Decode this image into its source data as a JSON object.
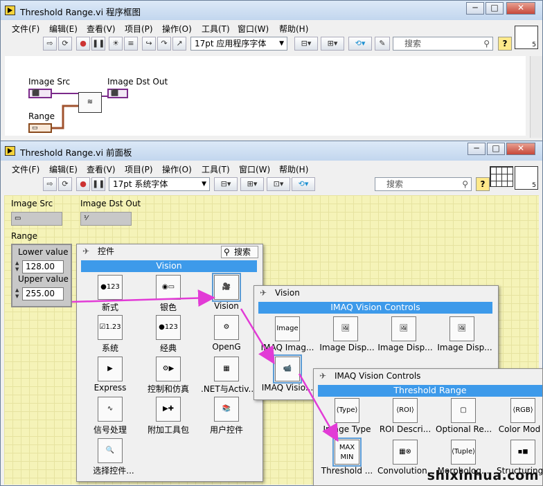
{
  "block_diagram": {
    "title": "Threshold Range.vi 程序框图",
    "menus": [
      "文件(F)",
      "编辑(E)",
      "查看(V)",
      "项目(P)",
      "操作(O)",
      "工具(T)",
      "窗口(W)",
      "帮助(H)"
    ],
    "font_select": "17pt 应用程序字体",
    "search_placeholder": "搜索",
    "labels": {
      "image_src": "Image Src",
      "image_dst_out": "Image Dst Out",
      "range": "Range"
    },
    "help": "?",
    "corner": "5"
  },
  "front_panel": {
    "title": "Threshold Range.vi 前面板",
    "menus": [
      "文件(F)",
      "编辑(E)",
      "查看(V)",
      "项目(P)",
      "操作(O)",
      "工具(T)",
      "窗口(W)",
      "帮助(H)"
    ],
    "font_select": "17pt 系统字体",
    "search_placeholder": "搜索",
    "help": "?",
    "corner": "5",
    "labels": {
      "image_src": "Image Src",
      "image_dst_out": "Image Dst Out",
      "range": "Range"
    },
    "range": {
      "lower_label": "Lower value",
      "lower_value": "128.00",
      "upper_label": "Upper value",
      "upper_value": "255.00"
    }
  },
  "palette_controls": {
    "title": "控件",
    "search": "搜索",
    "header": "Vision",
    "items": [
      "新式",
      "银色",
      "Vision",
      "系统",
      "经典",
      "OpenG",
      "Express",
      "控制和仿真",
      ".NET与Activ...",
      "信号处理",
      "附加工具包",
      "用户控件",
      "选择控件..."
    ]
  },
  "palette_vision": {
    "title": "Vision",
    "header": "IMAQ Vision Controls",
    "items": [
      "IMAQ Imag...",
      "Image Disp...",
      "Image Disp...",
      "Image Disp...",
      "IMAQ Visio..."
    ]
  },
  "palette_imaq": {
    "title": "IMAQ Vision Controls",
    "header": "Threshold Range",
    "items": [
      "Image Type",
      "ROI Descri...",
      "Optional Re...",
      "Color Mod",
      "Threshold ...",
      "Convolution...",
      "Morpholog...",
      "Structuring"
    ]
  },
  "watermark": "shixinhua.com",
  "colors": {
    "accent": "#3d9aea",
    "arrow": "#e23bd6",
    "panel_bg": "#f5f3b8"
  }
}
